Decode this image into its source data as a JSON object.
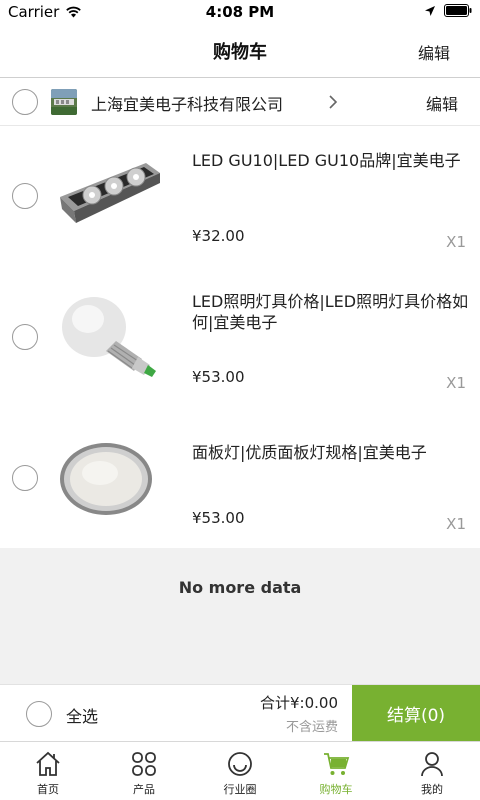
{
  "status_bar": {
    "carrier": "Carrier",
    "time": "4:08 PM"
  },
  "nav": {
    "title": "购物车",
    "edit_label": "编辑"
  },
  "shop": {
    "name": "上海宜美电子科技有限公司",
    "edit_label": "编辑"
  },
  "items": [
    {
      "title": "LED GU10|LED GU10品牌|宜美电子",
      "price": "¥32.00",
      "qty": "X1",
      "image_icon": "grille-led-lamp-image"
    },
    {
      "title": "LED照明灯具价格|LED照明灯具价格如何|宜美电子",
      "price": "¥53.00",
      "qty": "X1",
      "image_icon": "led-bulb-image"
    },
    {
      "title": "面板灯|优质面板灯规格|宜美电子",
      "price": "¥53.00",
      "qty": "X1",
      "image_icon": "round-panel-light-image"
    }
  ],
  "no_more": "No more data",
  "checkout": {
    "select_all": "全选",
    "total": "合计¥:0.00",
    "shipping_note": "不含运费",
    "checkout_label": "结算(0)"
  },
  "tabs": [
    {
      "label": "首页",
      "icon": "home-icon"
    },
    {
      "label": "产品",
      "icon": "grid-icon"
    },
    {
      "label": "行业圈",
      "icon": "smiley-icon"
    },
    {
      "label": "购物车",
      "icon": "cart-icon",
      "active": true
    },
    {
      "label": "我的",
      "icon": "person-icon"
    }
  ],
  "colors": {
    "accent": "#78b131",
    "muted": "#999999",
    "divider": "#e8e8e8",
    "background_gray": "#f1f1f1"
  }
}
